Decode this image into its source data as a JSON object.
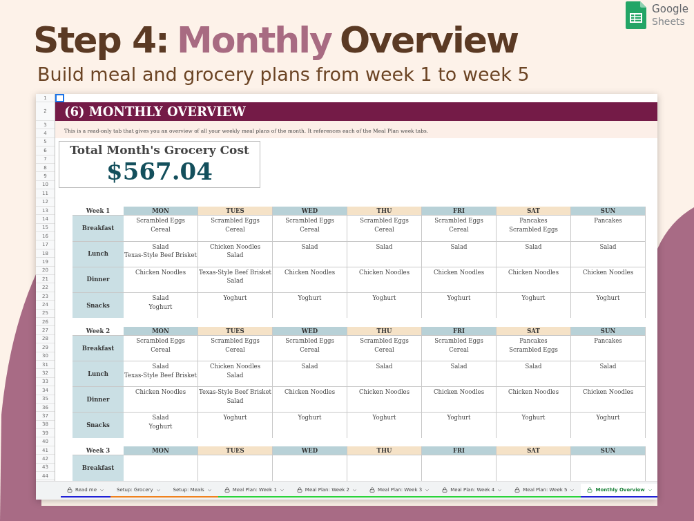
{
  "title_parts": [
    {
      "text": "Step 4:",
      "color": "#5b3a24"
    },
    {
      "text": "Monthly",
      "color": "#a86b82"
    },
    {
      "text": "Overview",
      "color": "#5b3a24"
    }
  ],
  "subtitle": "Build meal and grocery plans from week 1 to week 5",
  "logo": {
    "line1": "Google",
    "line2": "Sheets"
  },
  "sheet": {
    "row_numbers": [
      "1",
      "2",
      "3",
      "4",
      "5",
      "6",
      "7",
      "8",
      "9",
      "10",
      "11",
      "12",
      "13",
      "14",
      "15",
      "16",
      "17",
      "18",
      "19",
      "20",
      "21",
      "22",
      "23",
      "24",
      "25",
      "26",
      "27",
      "28",
      "29",
      "30",
      "31",
      "32",
      "33",
      "34",
      "35",
      "36",
      "37",
      "38",
      "39",
      "40",
      "41",
      "42",
      "43",
      "44"
    ],
    "heading": "(6) MONTHLY OVERVIEW",
    "description": "This is a read-only tab that gives you an overview of all your weekly meal plans of the month. It references each of the Meal Plan week tabs.",
    "cost_title": "Total Month's Grocery Cost",
    "cost_value": "$567.04",
    "weeks": [
      {
        "label": "Week 1",
        "days": [
          {
            "name": "MON",
            "color": "#b8d1d7"
          },
          {
            "name": "TUES",
            "color": "#f5e2c7"
          },
          {
            "name": "WED",
            "color": "#b8d1d7"
          },
          {
            "name": "THU",
            "color": "#f5e2c7"
          },
          {
            "name": "FRI",
            "color": "#b8d1d7"
          },
          {
            "name": "SAT",
            "color": "#f5e2c7"
          },
          {
            "name": "SUN",
            "color": "#b8d1d7"
          }
        ],
        "meals": [
          {
            "name": "Breakfast",
            "cells": [
              [
                "Scrambled Eggs",
                "Cereal"
              ],
              [
                "Scrambled Eggs",
                "Cereal"
              ],
              [
                "Scrambled Eggs",
                "Cereal"
              ],
              [
                "Scrambled Eggs",
                "Cereal"
              ],
              [
                "Scrambled Eggs",
                "Cereal"
              ],
              [
                "Pancakes",
                "Scrambled Eggs"
              ],
              [
                "Pancakes"
              ]
            ]
          },
          {
            "name": "Lunch",
            "cells": [
              [
                "Salad",
                "Texas-Style Beef Brisket"
              ],
              [
                "Chicken Noodles",
                "Salad"
              ],
              [
                "Salad"
              ],
              [
                "Salad"
              ],
              [
                "Salad"
              ],
              [
                "Salad"
              ],
              [
                "Salad"
              ]
            ]
          },
          {
            "name": "Dinner",
            "cells": [
              [
                "Chicken Noodles"
              ],
              [
                "Texas-Style Beef Brisket",
                "Salad"
              ],
              [
                "Chicken Noodles"
              ],
              [
                "Chicken Noodles"
              ],
              [
                "Chicken Noodles"
              ],
              [
                "Chicken Noodles"
              ],
              [
                "Chicken Noodles"
              ]
            ]
          },
          {
            "name": "Snacks",
            "cells": [
              [
                "Salad",
                "Yoghurt"
              ],
              [
                "Yoghurt"
              ],
              [
                "Yoghurt"
              ],
              [
                "Yoghurt"
              ],
              [
                "Yoghurt"
              ],
              [
                "Yoghurt"
              ],
              [
                "Yoghurt"
              ]
            ]
          }
        ]
      },
      {
        "label": "Week 2",
        "days": [
          {
            "name": "MON",
            "color": "#b8d1d7"
          },
          {
            "name": "TUES",
            "color": "#f5e2c7"
          },
          {
            "name": "WED",
            "color": "#b8d1d7"
          },
          {
            "name": "THU",
            "color": "#f5e2c7"
          },
          {
            "name": "FRI",
            "color": "#b8d1d7"
          },
          {
            "name": "SAT",
            "color": "#f5e2c7"
          },
          {
            "name": "SUN",
            "color": "#b8d1d7"
          }
        ],
        "meals": [
          {
            "name": "Breakfast",
            "cells": [
              [
                "Scrambled Eggs",
                "Cereal"
              ],
              [
                "Scrambled Eggs",
                "Cereal"
              ],
              [
                "Scrambled Eggs",
                "Cereal"
              ],
              [
                "Scrambled Eggs",
                "Cereal"
              ],
              [
                "Scrambled Eggs",
                "Cereal"
              ],
              [
                "Pancakes",
                "Scrambled Eggs"
              ],
              [
                "Pancakes"
              ]
            ]
          },
          {
            "name": "Lunch",
            "cells": [
              [
                "Salad",
                "Texas-Style Beef Brisket"
              ],
              [
                "Chicken Noodles",
                "Salad"
              ],
              [
                "Salad"
              ],
              [
                "Salad"
              ],
              [
                "Salad"
              ],
              [
                "Salad"
              ],
              [
                "Salad"
              ]
            ]
          },
          {
            "name": "Dinner",
            "cells": [
              [
                "Chicken Noodles"
              ],
              [
                "Texas-Style Beef Brisket",
                "Salad"
              ],
              [
                "Chicken Noodles"
              ],
              [
                "Chicken Noodles"
              ],
              [
                "Chicken Noodles"
              ],
              [
                "Chicken Noodles"
              ],
              [
                "Chicken Noodles"
              ]
            ]
          },
          {
            "name": "Snacks",
            "cells": [
              [
                "Salad",
                "Yoghurt"
              ],
              [
                "Yoghurt"
              ],
              [
                "Yoghurt"
              ],
              [
                "Yoghurt"
              ],
              [
                "Yoghurt"
              ],
              [
                "Yoghurt"
              ],
              [
                "Yoghurt"
              ]
            ]
          }
        ]
      },
      {
        "label": "Week 3",
        "days": [
          {
            "name": "MON",
            "color": "#b8d1d7"
          },
          {
            "name": "TUES",
            "color": "#f5e2c7"
          },
          {
            "name": "WED",
            "color": "#b8d1d7"
          },
          {
            "name": "THU",
            "color": "#f5e2c7"
          },
          {
            "name": "FRI",
            "color": "#b8d1d7"
          },
          {
            "name": "SAT",
            "color": "#f5e2c7"
          },
          {
            "name": "SUN",
            "color": "#b8d1d7"
          }
        ],
        "meals": [
          {
            "name": "Breakfast",
            "cells": [
              [],
              [],
              [],
              [],
              [],
              [],
              []
            ]
          }
        ]
      }
    ]
  },
  "tabs": [
    {
      "label": "Read me",
      "locked": true,
      "selected": false,
      "color": "#1f1fd6"
    },
    {
      "label": "Setup: Grocery",
      "locked": false,
      "selected": false,
      "color": "#f0821e"
    },
    {
      "label": "Setup: Meals",
      "locked": false,
      "selected": false,
      "color": "#f0821e"
    },
    {
      "label": "Meal Plan: Week 1",
      "locked": true,
      "selected": false,
      "color": "#2bd43a"
    },
    {
      "label": "Meal Plan: Week 2",
      "locked": true,
      "selected": false,
      "color": "#2bd43a"
    },
    {
      "label": "Meal Plan: Week 3",
      "locked": true,
      "selected": false,
      "color": "#2bd43a"
    },
    {
      "label": "Meal Plan: Week 4",
      "locked": true,
      "selected": false,
      "color": "#2bd43a"
    },
    {
      "label": "Meal Plan: Week 5",
      "locked": true,
      "selected": false,
      "color": "#2bd43a"
    },
    {
      "label": "Monthly Overview",
      "locked": true,
      "selected": true,
      "color": "#1f1fd6"
    }
  ]
}
